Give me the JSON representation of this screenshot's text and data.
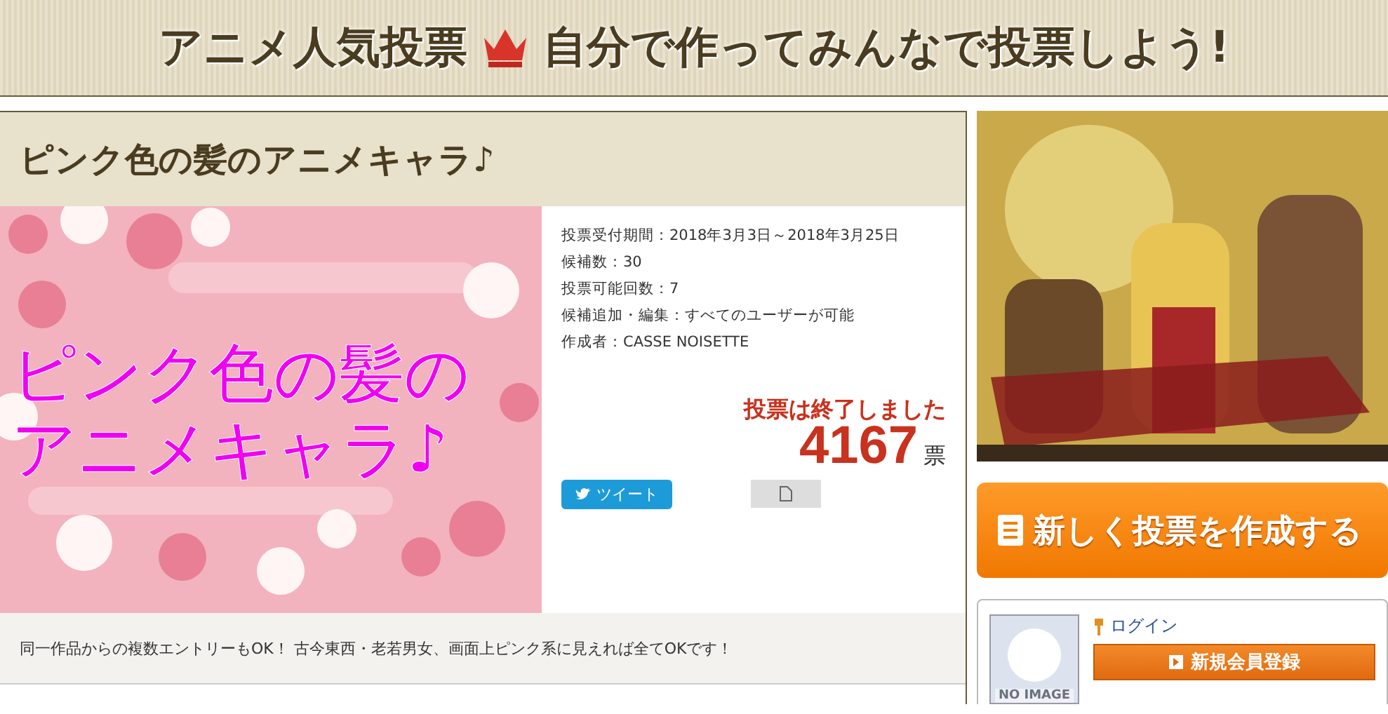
{
  "header": {
    "title_left": "アニメ人気投票",
    "title_right": "自分で作ってみんなで投票しよう!"
  },
  "poll": {
    "title": "ピンク色の髪のアニメキャラ♪",
    "image": {
      "kind": "picture",
      "caption": [
        "ピンク色の髪の",
        "アニメキャラ♪"
      ]
    },
    "info": [
      "投票受付期間：2018年3月3日～2018年3月25日",
      "候補数：30",
      "投票可能回数：7",
      "候補追加・編集：すべてのユーザーが可能",
      "作成者：CASSE NOISETTE"
    ],
    "status": "投票は終了しました",
    "votes": "4167",
    "votes_unit": "票",
    "tweet_button": "ツイート",
    "description": "同一作品からの複数エントリーもOK！ 古今東西・老若男女、画面上ピンク系に見えれば全てOKです！"
  },
  "sidebar": {
    "create_button": "新しく投票を作成する",
    "avatar_label": "NO IMAGE",
    "login_link": "ログイン",
    "register_button": "新規会員登録"
  }
}
